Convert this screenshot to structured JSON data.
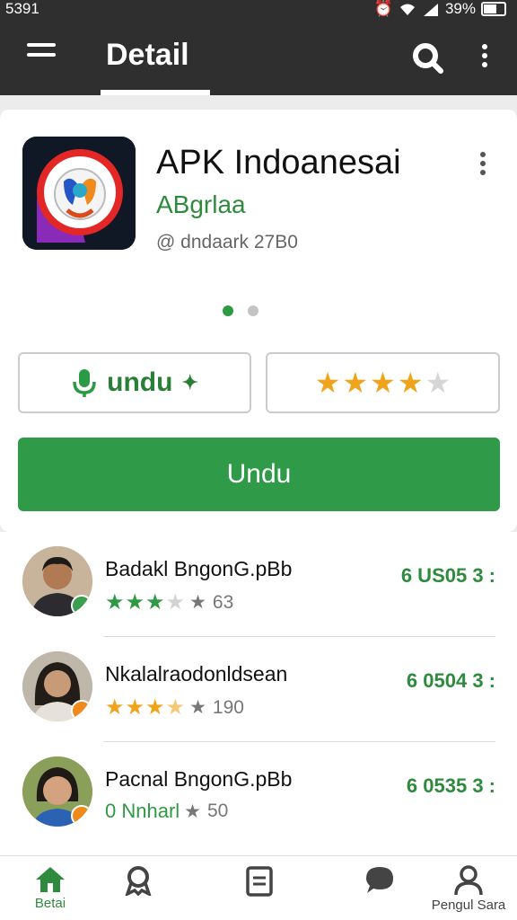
{
  "status_bar": {
    "time": "5391",
    "battery": "39%"
  },
  "app_bar": {
    "title": "Detail"
  },
  "app": {
    "name": "APK Indoanesai",
    "developer": "ABgrlaa",
    "meta": "@ dndaark 27B0"
  },
  "carousel": {
    "pages": 2,
    "active": 1
  },
  "actions": {
    "undu_label": "undu",
    "rating_stars": 4,
    "download_label": "Undu"
  },
  "reviews": [
    {
      "name": "Badakl BngonG.pBb",
      "stars": 3,
      "star_color": "green",
      "count": "63",
      "score": "6 US05 3 :"
    },
    {
      "name": "Nkalalraodonldsean",
      "stars": 3,
      "star_color": "orange",
      "count": "190",
      "score": "6 0504 3 :"
    },
    {
      "name": "Pacnal BngonG.pBb",
      "rating_text": "0 Nnharl",
      "count": "50",
      "score": "6 0535 3 :"
    }
  ],
  "bottom_nav": [
    {
      "icon": "home-icon",
      "label": "Betai",
      "active": true
    },
    {
      "icon": "award-icon",
      "label": ""
    },
    {
      "icon": "list-icon",
      "label": ""
    },
    {
      "icon": "chat-icon",
      "label": ""
    },
    {
      "icon": "person-icon",
      "label": "Pengul Sara"
    }
  ],
  "colors": {
    "accent": "#2f9a48",
    "star": "#f0a41c",
    "appbar": "#2f2f2f"
  }
}
